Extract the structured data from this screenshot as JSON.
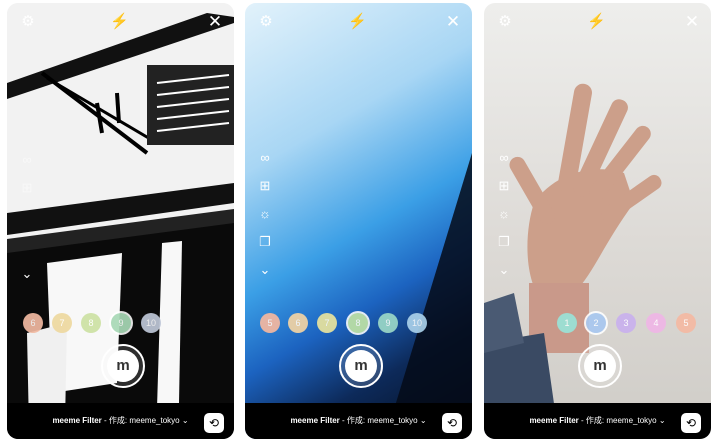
{
  "screens": [
    {
      "credit_title": "meeme Filter",
      "credit_rest": " - 作成: meeme_tokyo",
      "shutter_label": "m",
      "filters": [
        {
          "label": "6",
          "color": "#f2b9a1"
        },
        {
          "label": "7",
          "color": "#eed9a0"
        },
        {
          "label": "8",
          "color": "#cde2a4"
        },
        {
          "label": "9",
          "color": "#a8d9b6",
          "selected": true
        },
        {
          "label": "10",
          "color": "#bfc7d8"
        }
      ]
    },
    {
      "credit_title": "meeme Filter",
      "credit_rest": " - 作成: meeme_tokyo",
      "shutter_label": "m",
      "filters": [
        {
          "label": "5",
          "color": "#f5b8a0"
        },
        {
          "label": "6",
          "color": "#f3d4a4"
        },
        {
          "label": "7",
          "color": "#e9e49e"
        },
        {
          "label": "8",
          "color": "#bfe3a6",
          "selected": true
        },
        {
          "label": "9",
          "color": "#9bd8c7"
        },
        {
          "label": "10",
          "color": "#a9d0ea"
        }
      ]
    },
    {
      "credit_title": "meeme Filter",
      "credit_rest": " - 作成: meeme_tokyo",
      "shutter_label": "m",
      "filters": [
        {
          "label": "1",
          "color": "#9ae3d8"
        },
        {
          "label": "2",
          "color": "#a9c8f0",
          "selected": true
        },
        {
          "label": "3",
          "color": "#c9b1ee"
        },
        {
          "label": "4",
          "color": "#efb6e6"
        },
        {
          "label": "5",
          "color": "#f5b9a3"
        }
      ]
    }
  ],
  "icons": {
    "settings": "gear-icon",
    "flash": "flash-off-icon",
    "close": "close-icon",
    "infinity": "infinity-icon",
    "layout": "layout-icon",
    "brightness": "brightness-icon",
    "stickers": "sticker-icon",
    "more": "chevron-down-icon",
    "flip": "flip-camera-icon"
  }
}
